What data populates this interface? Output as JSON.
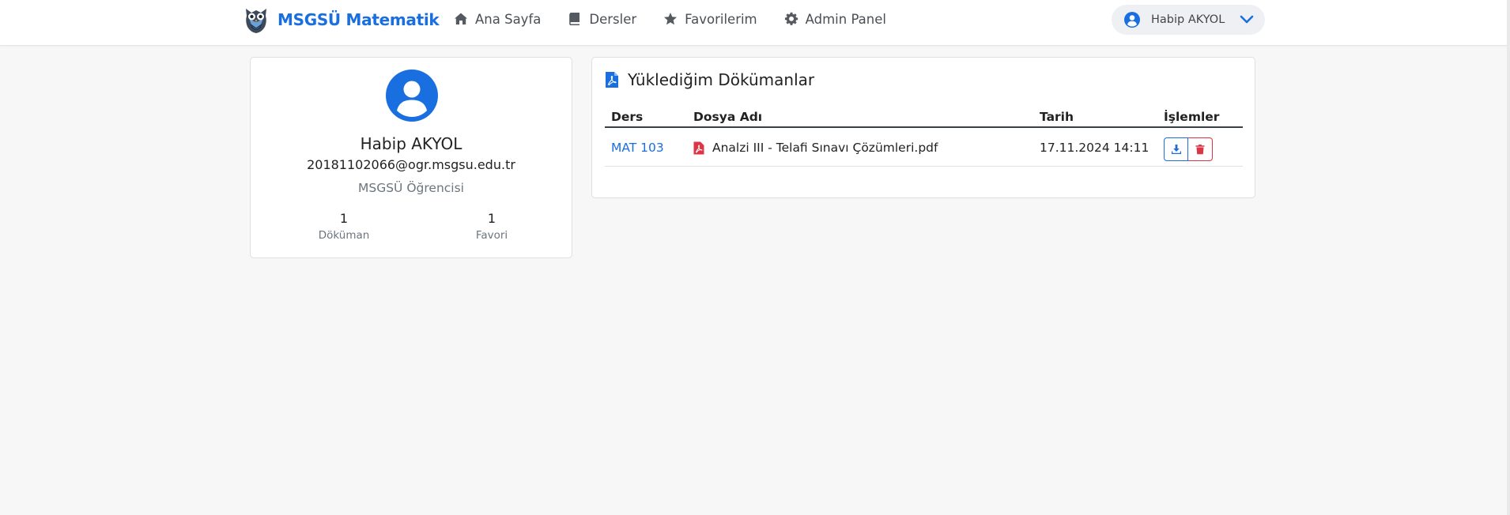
{
  "brand": {
    "name": "MSGSÜ Matematik",
    "logo": "owl-logo"
  },
  "nav": [
    {
      "label": "Ana Sayfa",
      "icon": "home-icon"
    },
    {
      "label": "Dersler",
      "icon": "book-icon"
    },
    {
      "label": "Favorilerim",
      "icon": "star-icon"
    },
    {
      "label": "Admin Panel",
      "icon": "gear-icon"
    }
  ],
  "user_menu": {
    "name": "Habip AKYOL",
    "icon": "user-circle-icon",
    "caret": "chevron-down-icon"
  },
  "profile": {
    "name": "Habip AKYOL",
    "email": "20181102066@ogr.msgsu.edu.tr",
    "role": "MSGSÜ Öğrencisi",
    "stats": [
      {
        "value": "1",
        "label": "Döküman"
      },
      {
        "value": "1",
        "label": "Favori"
      }
    ]
  },
  "documents": {
    "title": "Yüklediğim Dökümanlar",
    "columns": [
      "Ders",
      "Dosya Adı",
      "Tarih",
      "İşlemler"
    ],
    "rows": [
      {
        "course": "MAT 103",
        "file": "Analzi III - Telafi Sınavı Çözümleri.pdf",
        "date": "17.11.2024 14:11"
      }
    ]
  },
  "colors": {
    "primary": "#1a6fe0",
    "danger": "#dc3545",
    "text": "#212529",
    "muted": "#6c757d",
    "background": "#f7f7f8"
  }
}
